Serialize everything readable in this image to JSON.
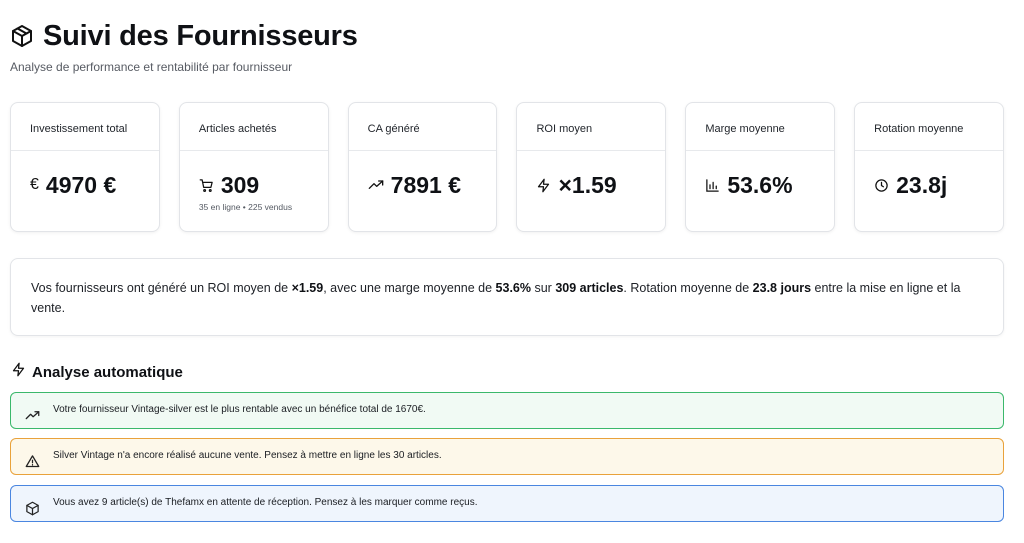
{
  "header": {
    "title": "Suivi des Fournisseurs",
    "subtitle": "Analyse de performance et rentabilité par fournisseur",
    "icon": "package-icon"
  },
  "kpis": [
    {
      "label": "Investissement total",
      "value": "4970 €",
      "icon": "euro-icon",
      "icon_glyph": "€",
      "sub": ""
    },
    {
      "label": "Articles achetés",
      "value": "309",
      "icon": "cart-icon",
      "sub": "35 en ligne • 225 vendus"
    },
    {
      "label": "CA généré",
      "value": "7891 €",
      "icon": "trending-up-icon",
      "sub": ""
    },
    {
      "label": "ROI moyen",
      "value": "×1.59",
      "icon": "zap-icon",
      "sub": ""
    },
    {
      "label": "Marge moyenne",
      "value": "53.6%",
      "icon": "bar-chart-icon",
      "sub": ""
    },
    {
      "label": "Rotation moyenne",
      "value": "23.8j",
      "icon": "clock-icon",
      "sub": ""
    }
  ],
  "summary": {
    "t1": "Vos fournisseurs ont généré un ROI moyen de ",
    "roi": "×1.59",
    "t2": ", avec une marge moyenne de ",
    "marge": "53.6%",
    "t3": " sur ",
    "articles": "309 articles",
    "t4": ". Rotation moyenne de ",
    "rotation": "23.8 jours",
    "t5": " entre la mise en ligne et la vente."
  },
  "analysis": {
    "title": "Analyse automatique",
    "alerts": [
      {
        "type": "success",
        "icon": "trending-up-icon",
        "text": "Votre fournisseur Vintage-silver est le plus rentable avec un bénéfice total de 1670€."
      },
      {
        "type": "warning",
        "icon": "warning-icon",
        "text": "Silver Vintage n'a encore réalisé aucune vente. Pensez à mettre en ligne les 30 articles."
      },
      {
        "type": "info",
        "icon": "package-icon",
        "text": "Vous avez 9 article(s) de Thefamx en attente de réception. Pensez à les marquer comme reçus."
      }
    ]
  },
  "colors": {
    "success_border": "#3bb86b",
    "warning_border": "#e9a23b",
    "info_border": "#4a86e0"
  }
}
